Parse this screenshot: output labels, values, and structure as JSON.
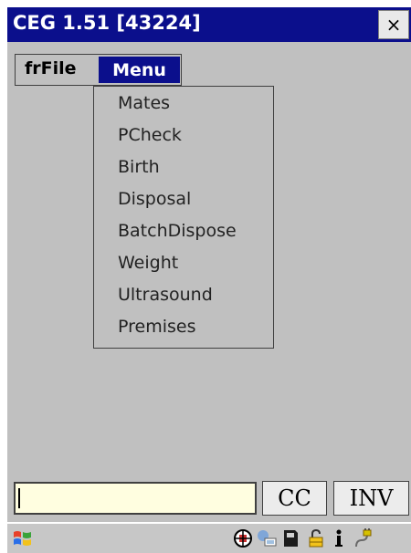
{
  "window": {
    "title": "CEG 1.51 [43224]",
    "close_label": "×"
  },
  "menubar": {
    "items": [
      {
        "label": "frFile"
      },
      {
        "label": "Menu"
      }
    ]
  },
  "dropdown": {
    "items": [
      {
        "label": "Mates"
      },
      {
        "label": "PCheck"
      },
      {
        "label": "Birth"
      },
      {
        "label": "Disposal"
      },
      {
        "label": "BatchDispose"
      },
      {
        "label": "Weight"
      },
      {
        "label": "Ultrasound"
      },
      {
        "label": "Premises"
      }
    ]
  },
  "bottom_bar": {
    "input_value": "",
    "cc_label": "CC",
    "inv_label": "INV"
  },
  "taskbar": {
    "icons": [
      "windows-start-icon",
      "network-icon",
      "connection-icon",
      "storage-card-icon",
      "lock-icon",
      "info-icon",
      "power-plug-icon"
    ]
  },
  "colors": {
    "title_bar": "#0b0f8c",
    "menu_highlight": "#0b0f8c",
    "background": "#c0c0c0",
    "input_background": "#fffee0"
  }
}
